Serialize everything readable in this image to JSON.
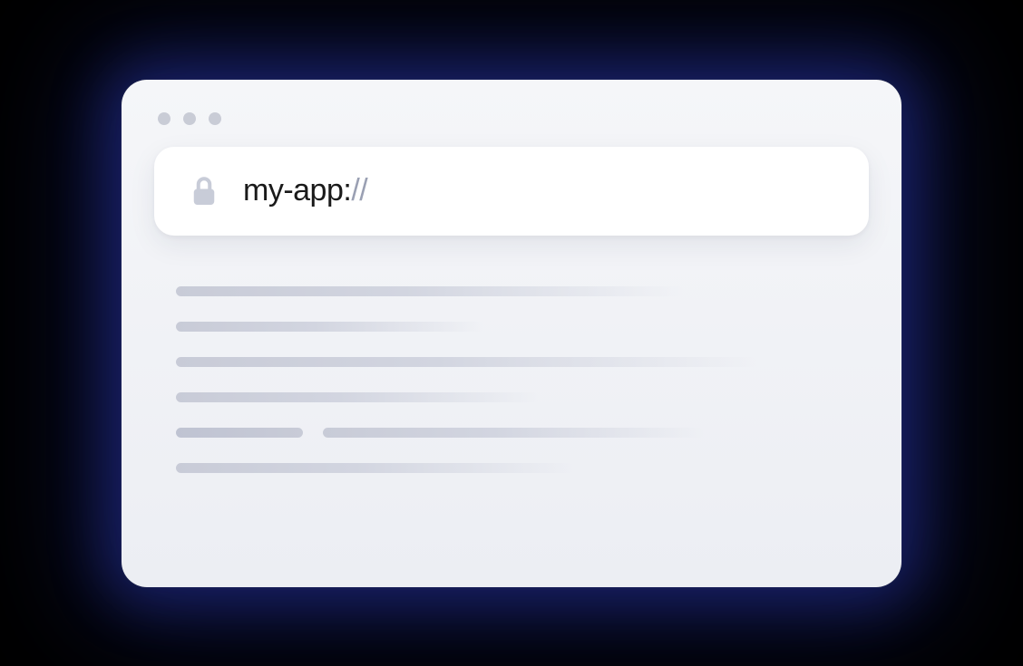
{
  "address_bar": {
    "url_scheme": "my-app:",
    "url_separator": "//"
  }
}
